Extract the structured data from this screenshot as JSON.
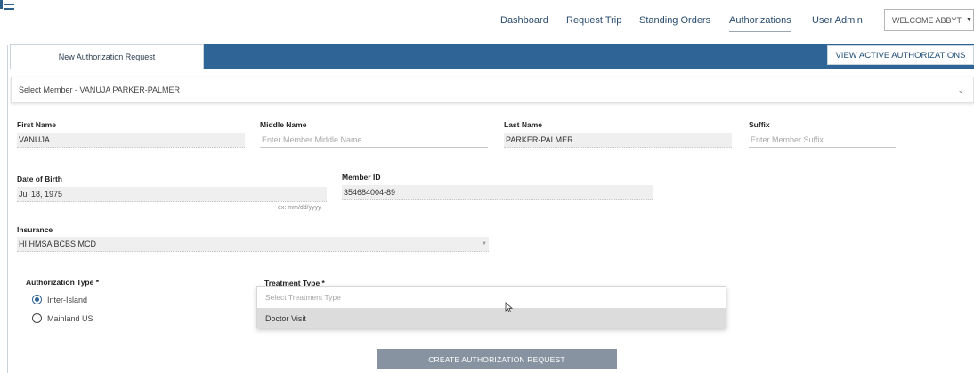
{
  "nav": {
    "items": [
      "Dashboard",
      "Request Trip",
      "Standing Orders",
      "Authorizations",
      "User Admin"
    ],
    "active": "Authorizations",
    "welcome": "WELCOME ABBYT"
  },
  "tabs": {
    "active_label": "New Authorization Request",
    "view_active_label": "VIEW ACTIVE AUTHORIZATIONS"
  },
  "member_select": {
    "label": "Select Member - VANUJA PARKER-PALMER"
  },
  "form": {
    "first_name": {
      "label": "First Name",
      "value": "VANUJA"
    },
    "middle_name": {
      "label": "Middle Name",
      "placeholder": "Enter Member Middle Name"
    },
    "last_name": {
      "label": "Last Name",
      "value": "PARKER-PALMER"
    },
    "suffix": {
      "label": "Suffix",
      "placeholder": "Enter Member Suffix"
    },
    "dob": {
      "label": "Date of Birth",
      "value": "Jul 18, 1975",
      "hint": "ex: mm/dd/yyyy"
    },
    "member_id": {
      "label": "Member ID",
      "value": "354684004-89"
    },
    "insurance": {
      "label": "Insurance",
      "value": "HI HMSA BCBS MCD"
    },
    "auth_type": {
      "label": "Authorization Type *",
      "options": [
        "Inter-Island",
        "Mainland US"
      ],
      "selected": "Inter-Island"
    },
    "treatment_type": {
      "label": "Treatment Type *",
      "placeholder": "Select Treatment Type",
      "options": [
        "Doctor Visit"
      ]
    }
  },
  "submit_label": "CREATE AUTHORIZATION REQUEST",
  "icons": {
    "logo": "logo-icon",
    "member_chevron": "chevron-down-icon",
    "welcome_caret": "caret-down-icon",
    "insurance_caret": "caret-down-icon",
    "cursor": "mouse-pointer-icon"
  },
  "colors": {
    "tab_bar": "#2f6496",
    "nav_text": "#2a4d6e",
    "submit_button": "#8793a0",
    "option_highlight": "#dcdcdc"
  }
}
